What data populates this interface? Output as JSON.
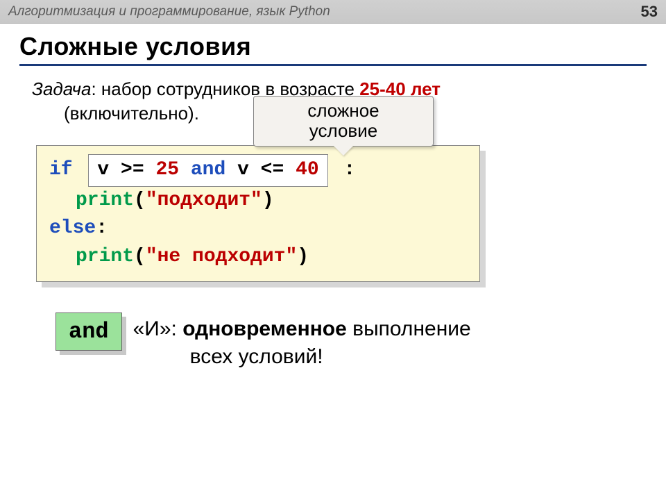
{
  "header": {
    "title": "Алгоритмизация и программирование, язык Python",
    "page": "53"
  },
  "slide": {
    "title": "Сложные условия"
  },
  "task": {
    "label": "Задача",
    "text_before": ": набор сотрудников в возрасте ",
    "range": "25-40 лет",
    "line2": "(включительно)."
  },
  "callout": {
    "line1": "сложное",
    "line2": "условие"
  },
  "code": {
    "if": "if",
    "cond_v1": "v >= ",
    "cond_n1": "25",
    "cond_and": " and ",
    "cond_v2": "v <= ",
    "cond_n2": "40",
    "colon": ":",
    "print": "print",
    "str_ok": "\"подходит\"",
    "else": "else",
    "str_no": "\"не подходит\""
  },
  "explain": {
    "badge": "and",
    "quote_i": "«И»: ",
    "bold": "одновременное",
    "tail1": " выполнение",
    "line2": "всех условий!"
  }
}
